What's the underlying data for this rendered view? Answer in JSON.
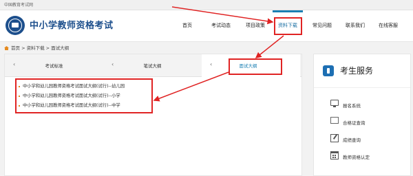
{
  "topbar": {
    "text": "中国教育考试网"
  },
  "header": {
    "site_title": "中小学教师资格考试",
    "nav": [
      {
        "label": "首页"
      },
      {
        "label": "考试动态"
      },
      {
        "label": "项目政策"
      },
      {
        "label": "资料下载"
      },
      {
        "label": "常见问题"
      },
      {
        "label": "联系我们"
      },
      {
        "label": "在线客服"
      }
    ]
  },
  "breadcrumb": {
    "text": "首页 > 资料下载 > 面试大纲"
  },
  "tabs": [
    {
      "label": "考试标准"
    },
    {
      "label": "笔试大纲"
    },
    {
      "label": "面试大纲"
    }
  ],
  "list": [
    "中小学和幼儿园教师资格考试面试大纲(试行)--幼儿园",
    "中小学和幼儿园教师资格考试面试大纲(试行)--小学",
    "中小学和幼儿园教师资格考试面试大纲(试行)--中学"
  ],
  "side": {
    "title": "考生服务",
    "items": [
      {
        "label": "报名系统",
        "icon": "monitor-icon"
      },
      {
        "label": "合格证查询",
        "icon": "certificate-icon"
      },
      {
        "label": "成绩查询",
        "icon": "edit-icon"
      },
      {
        "label": "教师资格认定",
        "icon": "calendar-icon"
      }
    ]
  },
  "colors": {
    "brand": "#1d4f8c",
    "accent": "#1a7fb3",
    "highlight": "#e02323"
  }
}
